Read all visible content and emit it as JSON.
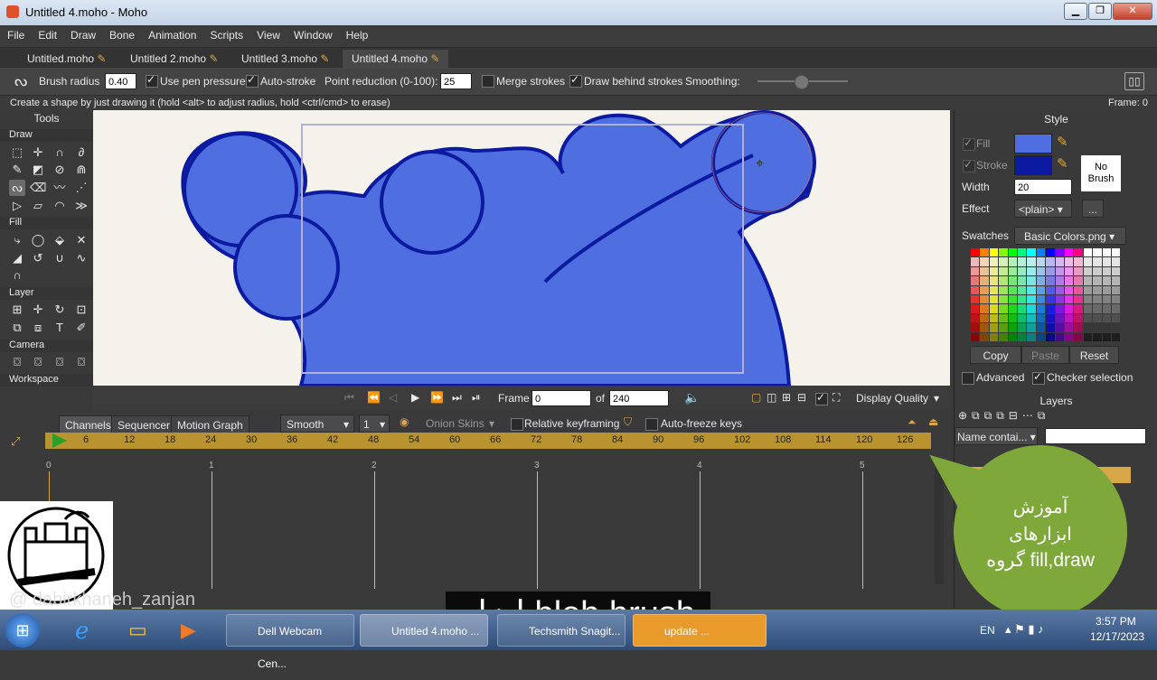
{
  "window": {
    "title": "Untitled 4.moho - Moho"
  },
  "menu": [
    "File",
    "Edit",
    "Draw",
    "Bone",
    "Animation",
    "Scripts",
    "View",
    "Window",
    "Help"
  ],
  "tabs": [
    "Untitled.moho",
    "Untitled 2.moho",
    "Untitled 3.moho",
    "Untitled 4.moho"
  ],
  "toolbar": {
    "brush_radius_label": "Brush radius",
    "brush_radius_value": "0.40",
    "use_pen_pressure": "Use pen pressure",
    "auto_stroke": "Auto-stroke",
    "point_reduction_label": "Point reduction (0-100):",
    "point_reduction_value": "25",
    "merge_strokes": "Merge strokes",
    "draw_behind_strokes": "Draw behind strokes",
    "smoothing_label": "Smoothing:"
  },
  "status": {
    "hint": "Create a shape by just drawing it (hold <alt> to adjust radius, hold <ctrl/cmd> to erase)",
    "frame": "Frame: 0"
  },
  "tools": {
    "title": "Tools",
    "sections": [
      "Draw",
      "Fill",
      "Layer",
      "Camera",
      "Workspace"
    ]
  },
  "style": {
    "title": "Style",
    "fill_label": "Fill",
    "stroke_label": "Stroke",
    "fill_color": "#4f6ee0",
    "stroke_color": "#0b1aa0",
    "no_brush": "No Brush",
    "width_label": "Width",
    "width_value": "20",
    "effect_label": "Effect",
    "effect_value": "<plain>",
    "effect_more": "...",
    "swatches_label": "Swatches",
    "swatches_value": "Basic Colors.png",
    "copy": "Copy",
    "paste": "Paste",
    "reset": "Reset",
    "advanced": "Advanced",
    "checker_selection": "Checker selection"
  },
  "playback": {
    "frame_label": "Frame",
    "frame_value": "0",
    "of_label": "of",
    "total_frames": "240",
    "display_quality": "Display Quality"
  },
  "layers": {
    "title": "Layers",
    "name_filter": "Name contai..."
  },
  "timeline": {
    "tabs": [
      "Channels",
      "Sequencer",
      "Motion Graph"
    ],
    "interpolation": "Smooth",
    "step": "1",
    "onion_skins": "Onion Skins",
    "relative_keyframing": "Relative keyframing",
    "auto_freeze_keys": "Auto-freeze keys",
    "ruler_ticks": [
      "6",
      "12",
      "18",
      "24",
      "30",
      "36",
      "42",
      "48",
      "54",
      "60",
      "66",
      "72",
      "78",
      "84",
      "90",
      "96",
      "102",
      "108",
      "114",
      "120",
      "126"
    ],
    "second_marks": [
      "0",
      "1",
      "2",
      "3",
      "4",
      "5"
    ]
  },
  "taskbar": {
    "items": [
      "Dell Webcam Cen...",
      "Untitled 4.moho ...",
      "Techsmith Snagit...",
      "update ..."
    ],
    "lang": "EN",
    "time": "3:57 PM",
    "date": "12/17/2023"
  },
  "overlay": {
    "caption": "ابزار blob brush",
    "bubble_lines": [
      "آموزش",
      "ابزارهای",
      "گروه fill,draw"
    ],
    "watermark": "@ dabirkhaneh_zanjan"
  }
}
